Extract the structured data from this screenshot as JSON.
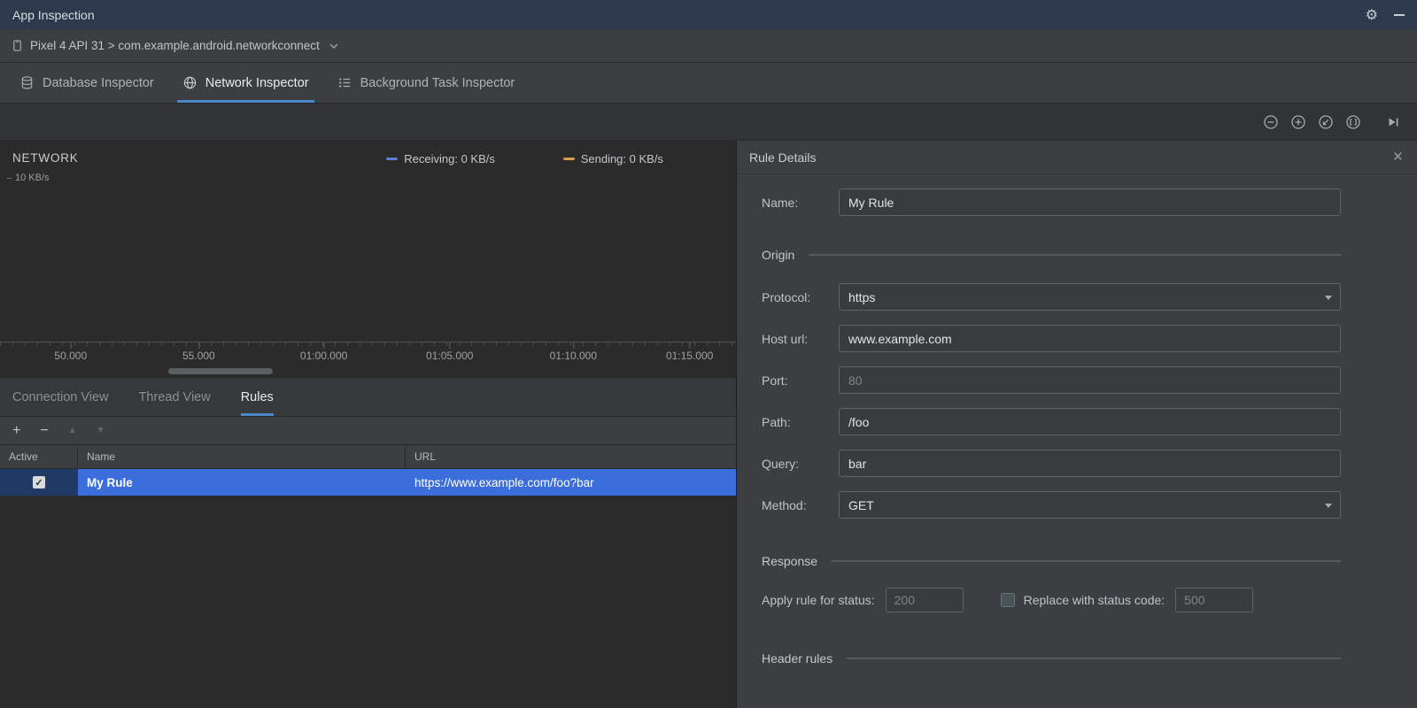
{
  "colors": {
    "accent_underline": "#4A88C7",
    "selection_blue": "#3B6EDA",
    "receiving": "#5B7FD0",
    "sending": "#D89C52"
  },
  "titlebar": {
    "title": "App Inspection"
  },
  "device_bar": {
    "selector": "Pixel 4 API 31 > com.example.android.networkconnect"
  },
  "inspector_tabs": [
    {
      "label": "Database Inspector",
      "icon": "database-icon",
      "selected": false
    },
    {
      "label": "Network Inspector",
      "icon": "globe-icon",
      "selected": true
    },
    {
      "label": "Background Task Inspector",
      "icon": "task-list-icon",
      "selected": false
    }
  ],
  "timeline_toolbar": {
    "icons": [
      "zoom-out-icon",
      "zoom-in-icon",
      "reset-zoom-icon",
      "zoom-to-fit-icon",
      "go-live-icon"
    ]
  },
  "chart": {
    "title": "NETWORK",
    "y_axis_label": "10 KB/s",
    "legend": [
      {
        "label": "Receiving: 0 KB/s",
        "color": "#5B7FD0"
      },
      {
        "label": "Sending: 0 KB/s",
        "color": "#D89C52"
      }
    ],
    "x_ticks": [
      "50.000",
      "55.000",
      "01:00.000",
      "01:05.000",
      "01:10.000",
      "01:15.000"
    ]
  },
  "view_tabs": [
    {
      "label": "Connection View",
      "selected": false
    },
    {
      "label": "Thread View",
      "selected": false
    },
    {
      "label": "Rules",
      "selected": true
    }
  ],
  "rules_toolbar": {
    "icons": [
      "add-icon",
      "remove-icon",
      "move-up-icon",
      "move-down-icon"
    ]
  },
  "rules_table": {
    "columns": [
      "Active",
      "Name",
      "URL"
    ],
    "rows": [
      {
        "active": true,
        "name": "My Rule",
        "url": "https://www.example.com/foo?bar",
        "selected": true
      }
    ]
  },
  "rule_details": {
    "title": "Rule Details",
    "name_label": "Name:",
    "name_value": "My Rule",
    "sections": {
      "origin": "Origin",
      "response": "Response",
      "header_rules": "Header rules"
    },
    "origin_fields": [
      {
        "label": "Protocol:",
        "value": "https",
        "type": "dropdown"
      },
      {
        "label": "Host url:",
        "value": "www.example.com",
        "type": "text"
      },
      {
        "label": "Port:",
        "placeholder": "80",
        "type": "text"
      },
      {
        "label": "Path:",
        "value": "/foo",
        "type": "text"
      },
      {
        "label": "Query:",
        "value": "bar",
        "type": "text"
      },
      {
        "label": "Method:",
        "value": "GET",
        "type": "dropdown"
      }
    ],
    "response": {
      "apply_label": "Apply rule for status:",
      "apply_placeholder": "200",
      "replace_label": "Replace with status code:",
      "replace_placeholder": "500",
      "replace_checked": false
    }
  }
}
